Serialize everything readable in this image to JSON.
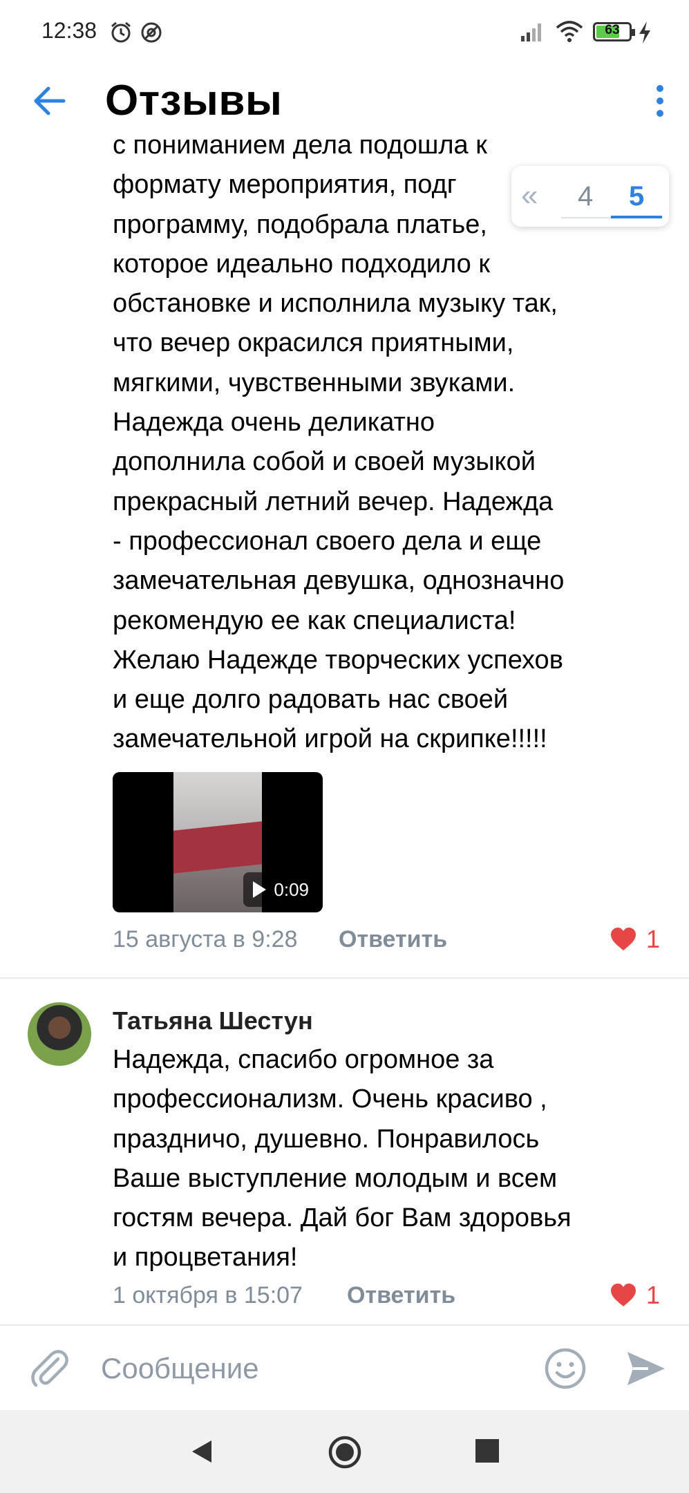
{
  "status_bar": {
    "time": "12:38",
    "battery_level": "63",
    "icons": [
      "alarm-icon",
      "do-not-disturb-icon",
      "signal-icon",
      "wifi-icon",
      "battery-icon",
      "charging-icon"
    ]
  },
  "header": {
    "title": "Отзывы",
    "back_icon": "arrow-left-icon",
    "menu_icon": "more-vertical-icon",
    "accent_color": "#2d81e0"
  },
  "pagination": {
    "prev_label": "«",
    "pages": [
      "4",
      "5"
    ],
    "current_page": "5"
  },
  "comments": [
    {
      "text": "с пониманием дела подошла к\nформату мероприятия, подг\nпрограмму, подобрала платье,\nкоторое идеально подходило к\nобстановке и исполнила музыку так,\nчто вечер окрасился приятными,\nмягкими, чувственными звуками.\nНадежда очень деликатно\nдополнила собой и своей музыкой\nпрекрасный летний вечер. Надежда\n- профессионал своего дела и еще\nзамечательная девушка, однозначно\nрекомендую ее как специалиста!\nЖелаю Надежде творческих успехов\nи еще долго радовать нас своей\nзамечательной игрой на скрипке!!!!!",
      "video_duration": "0:09",
      "date": "15 августа в 9:28",
      "reply_label": "Ответить",
      "likes": "1"
    },
    {
      "author": "Татьяна Шестун",
      "text": "Надежда, спасибо огромное за\nпрофессионализм. Очень красиво ,\nпраздничо, душевно. Понравилось\nВаше выступление молодым и всем\nгостям вечера. Дай бог Вам здоровья\nи процветания!",
      "date": "1 октября в 15:07",
      "reply_label": "Ответить",
      "likes": "1"
    }
  ],
  "composer": {
    "placeholder": "Сообщение",
    "icons": [
      "paperclip-icon",
      "emoji-icon",
      "send-icon"
    ]
  },
  "colors": {
    "like_red": "#e64646",
    "secondary_text": "#818c99"
  }
}
